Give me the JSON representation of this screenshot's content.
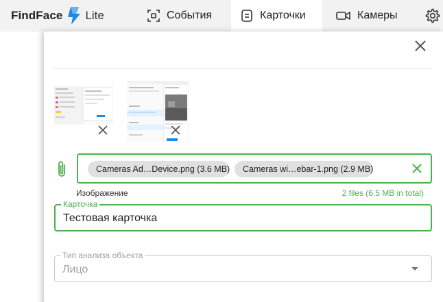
{
  "header": {
    "brand": "FindFace",
    "edition": "Lite",
    "nav": [
      {
        "label": "События",
        "icon": "face-scan-icon"
      },
      {
        "label": "Карточки",
        "icon": "card-icon"
      },
      {
        "label": "Камеры",
        "icon": "video-camera-icon"
      }
    ],
    "active_tab": "Карточки",
    "settings_icon": "gear-icon"
  },
  "dialog": {
    "close_icon": "close-icon",
    "images": [
      {
        "icon": "screenshot-thumbnail",
        "remove_icon": "close-icon"
      },
      {
        "icon": "screenshot-thumbnail",
        "remove_icon": "close-icon"
      }
    ],
    "upload": {
      "attach_icon": "paperclip-icon",
      "files": [
        "Cameras Ad…Device.png (3.6 MB)",
        "Cameras wi…ebar-1.png (2.9 MB)"
      ],
      "label": "Изображение",
      "summary": "2 files (6.5 MB in total)",
      "clear_icon": "close-icon"
    },
    "card_field": {
      "label": "Карточка",
      "value": "Тестовая карточка"
    },
    "analysis_field": {
      "label": "Тип анализа объекта",
      "value": "Лицо",
      "dropdown_icon": "caret-down-icon"
    }
  },
  "colors": {
    "accent": "#4caf50",
    "logo_blue": "#1e88e5",
    "topbar_bg": "#f2f2f2",
    "chip_bg": "#e0e0e0"
  }
}
